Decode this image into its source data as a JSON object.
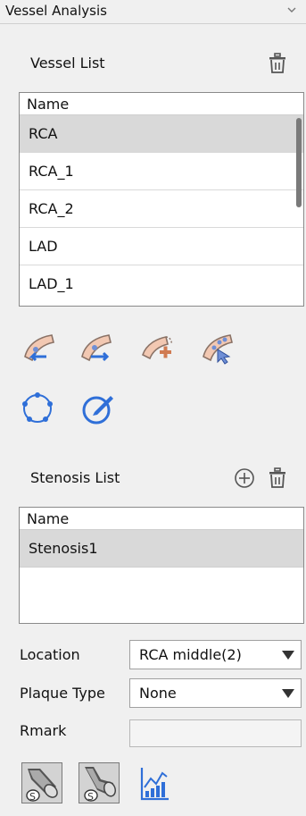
{
  "panel": {
    "title": "Vessel Analysis"
  },
  "vessel_list": {
    "label": "Vessel List",
    "column_header": "Name",
    "items": [
      "RCA",
      "RCA_1",
      "RCA_2",
      "LAD",
      "LAD_1"
    ],
    "selected_index": 0
  },
  "stenosis_list": {
    "label": "Stenosis List",
    "column_header": "Name",
    "items": [
      "Stenosis1"
    ],
    "selected_index": 0
  },
  "fields": {
    "location": {
      "label": "Location",
      "value": "RCA middle(2)"
    },
    "plaque_type": {
      "label": "Plaque Type",
      "value": "None"
    },
    "rmark": {
      "label": "Rmark",
      "value": ""
    }
  },
  "icons": {
    "vessel_tools": [
      "vessel-prev-icon",
      "vessel-next-icon",
      "vessel-add-icon",
      "vessel-select-icon"
    ],
    "shape_tools": [
      "circle-points-icon",
      "edit-contour-icon"
    ],
    "bottom_tools": [
      "straight-vessel-icon",
      "curved-vessel-icon",
      "chart-icon"
    ]
  },
  "colors": {
    "vessel_fill": "#f2c8b2",
    "vessel_stroke": "#8a7266",
    "arrow_blue": "#2f6fd8",
    "accent_plus": "#d07b52"
  }
}
